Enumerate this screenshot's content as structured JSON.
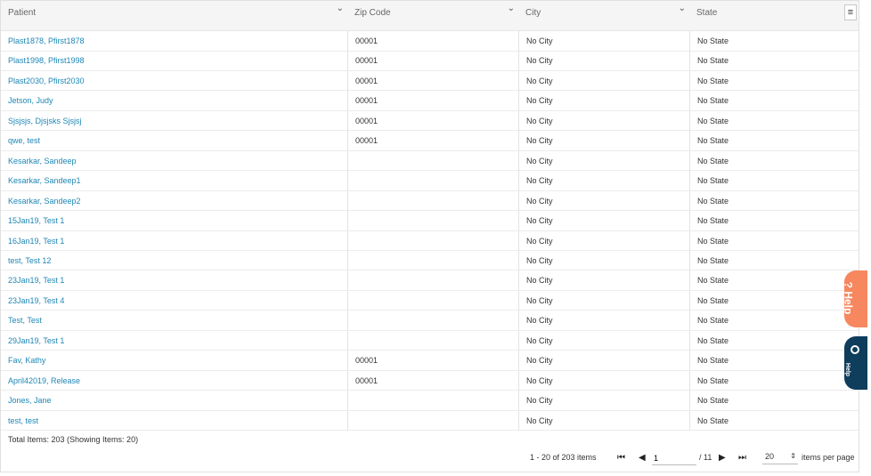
{
  "columns": [
    {
      "label": "Patient"
    },
    {
      "label": "Zip Code"
    },
    {
      "label": "City"
    },
    {
      "label": "State"
    }
  ],
  "rows": [
    {
      "patient": "Plast1878, Pfirst1878",
      "zip": "00001",
      "city": "No City",
      "state": "No State"
    },
    {
      "patient": "Plast1998, Pfirst1998",
      "zip": "00001",
      "city": "No City",
      "state": "No State"
    },
    {
      "patient": "Plast2030, Pfirst2030",
      "zip": "00001",
      "city": "No City",
      "state": "No State"
    },
    {
      "patient": "Jetson, Judy",
      "zip": "00001",
      "city": "No City",
      "state": "No State"
    },
    {
      "patient": "Sjsjsjs, Djsjsks Sjsjsj",
      "zip": "00001",
      "city": "No City",
      "state": "No State"
    },
    {
      "patient": "qwe, test",
      "zip": "00001",
      "city": "No City",
      "state": "No State"
    },
    {
      "patient": "Kesarkar, Sandeep",
      "zip": "",
      "city": "No City",
      "state": "No State"
    },
    {
      "patient": "Kesarkar, Sandeep1",
      "zip": "",
      "city": "No City",
      "state": "No State"
    },
    {
      "patient": "Kesarkar, Sandeep2",
      "zip": "",
      "city": "No City",
      "state": "No State"
    },
    {
      "patient": "15Jan19, Test 1",
      "zip": "",
      "city": "No City",
      "state": "No State"
    },
    {
      "patient": "16Jan19, Test 1",
      "zip": "",
      "city": "No City",
      "state": "No State"
    },
    {
      "patient": "test, Test 12",
      "zip": "",
      "city": "No City",
      "state": "No State"
    },
    {
      "patient": "23Jan19, Test 1",
      "zip": "",
      "city": "No City",
      "state": "No State"
    },
    {
      "patient": "23Jan19, Test 4",
      "zip": "",
      "city": "No City",
      "state": "No State"
    },
    {
      "patient": "Test, Test",
      "zip": "",
      "city": "No City",
      "state": "No State"
    },
    {
      "patient": "29Jan19, Test 1",
      "zip": "",
      "city": "No City",
      "state": "No State"
    },
    {
      "patient": "Fav, Kathy",
      "zip": "00001",
      "city": "No City",
      "state": "No State"
    },
    {
      "patient": "April42019, Release",
      "zip": "00001",
      "city": "No City",
      "state": "No State"
    },
    {
      "patient": "Jones, Jane",
      "zip": "",
      "city": "No City",
      "state": "No State"
    },
    {
      "patient": "test, test",
      "zip": "",
      "city": "No City",
      "state": "No State"
    }
  ],
  "footer": {
    "total_text": "Total Items: 203 (Showing Items: 20)",
    "range_text": "1 - 20 of 203 items",
    "page_value": "1",
    "page_total": "/ 11",
    "per_page_value": "20",
    "per_page_label": "items per page"
  },
  "help_tab": {
    "label": "? Help"
  },
  "help_widget": {
    "label": "Help"
  },
  "colors": {
    "link": "#1e87b5",
    "help_orange": "#f7875e",
    "help_navy": "#0f3d5c"
  }
}
